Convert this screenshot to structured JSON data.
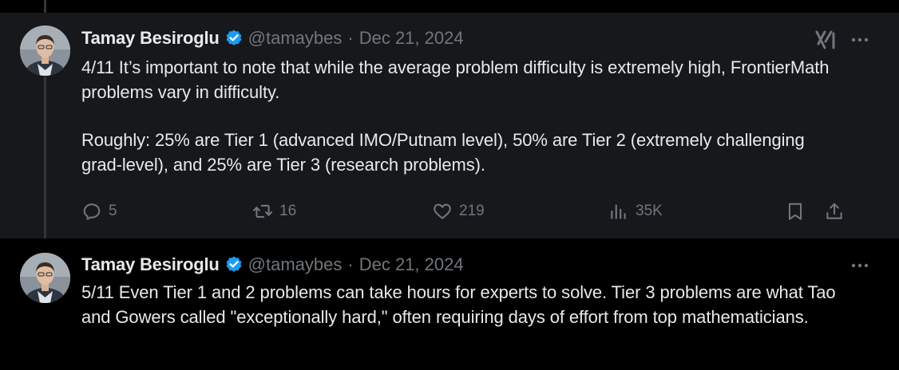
{
  "tweets": [
    {
      "author": "Tamay Besiroglu",
      "handle": "@tamaybes",
      "separator": "·",
      "date": "Dec 21, 2024",
      "paragraphs": [
        "4/11 It’s important to note that while the average problem difficulty is extremely high, FrontierMath problems vary in difficulty.",
        "Roughly: 25% are Tier 1 (advanced IMO/Putnam level), 50% are Tier 2 (extremely challenging grad-level), and 25% are Tier 3 (research problems)."
      ],
      "actions": {
        "replies": "5",
        "reposts": "16",
        "likes": "219",
        "views": "35K"
      }
    },
    {
      "author": "Tamay Besiroglu",
      "handle": "@tamaybes",
      "separator": "·",
      "date": "Dec 21, 2024",
      "paragraphs": [
        "5/11 Even Tier 1 and 2 problems can take hours for experts to solve. Tier 3 problems are what Tao and Gowers called \"exceptionally hard,\" often requiring days of effort from top mathematicians."
      ]
    }
  ],
  "icons": {
    "verified": "verified-badge-icon",
    "grok": "grok-icon",
    "more": "more-icon",
    "reply": "reply-icon",
    "repost": "repost-icon",
    "like": "like-icon",
    "views": "views-icon",
    "bookmark": "bookmark-icon",
    "share": "share-icon"
  },
  "colors": {
    "background": "#000000",
    "highlighted_tweet_bg": "#16181c",
    "primary_text": "#e7e9ea",
    "secondary_text": "#71767b",
    "verified": "#1d9bf0"
  }
}
